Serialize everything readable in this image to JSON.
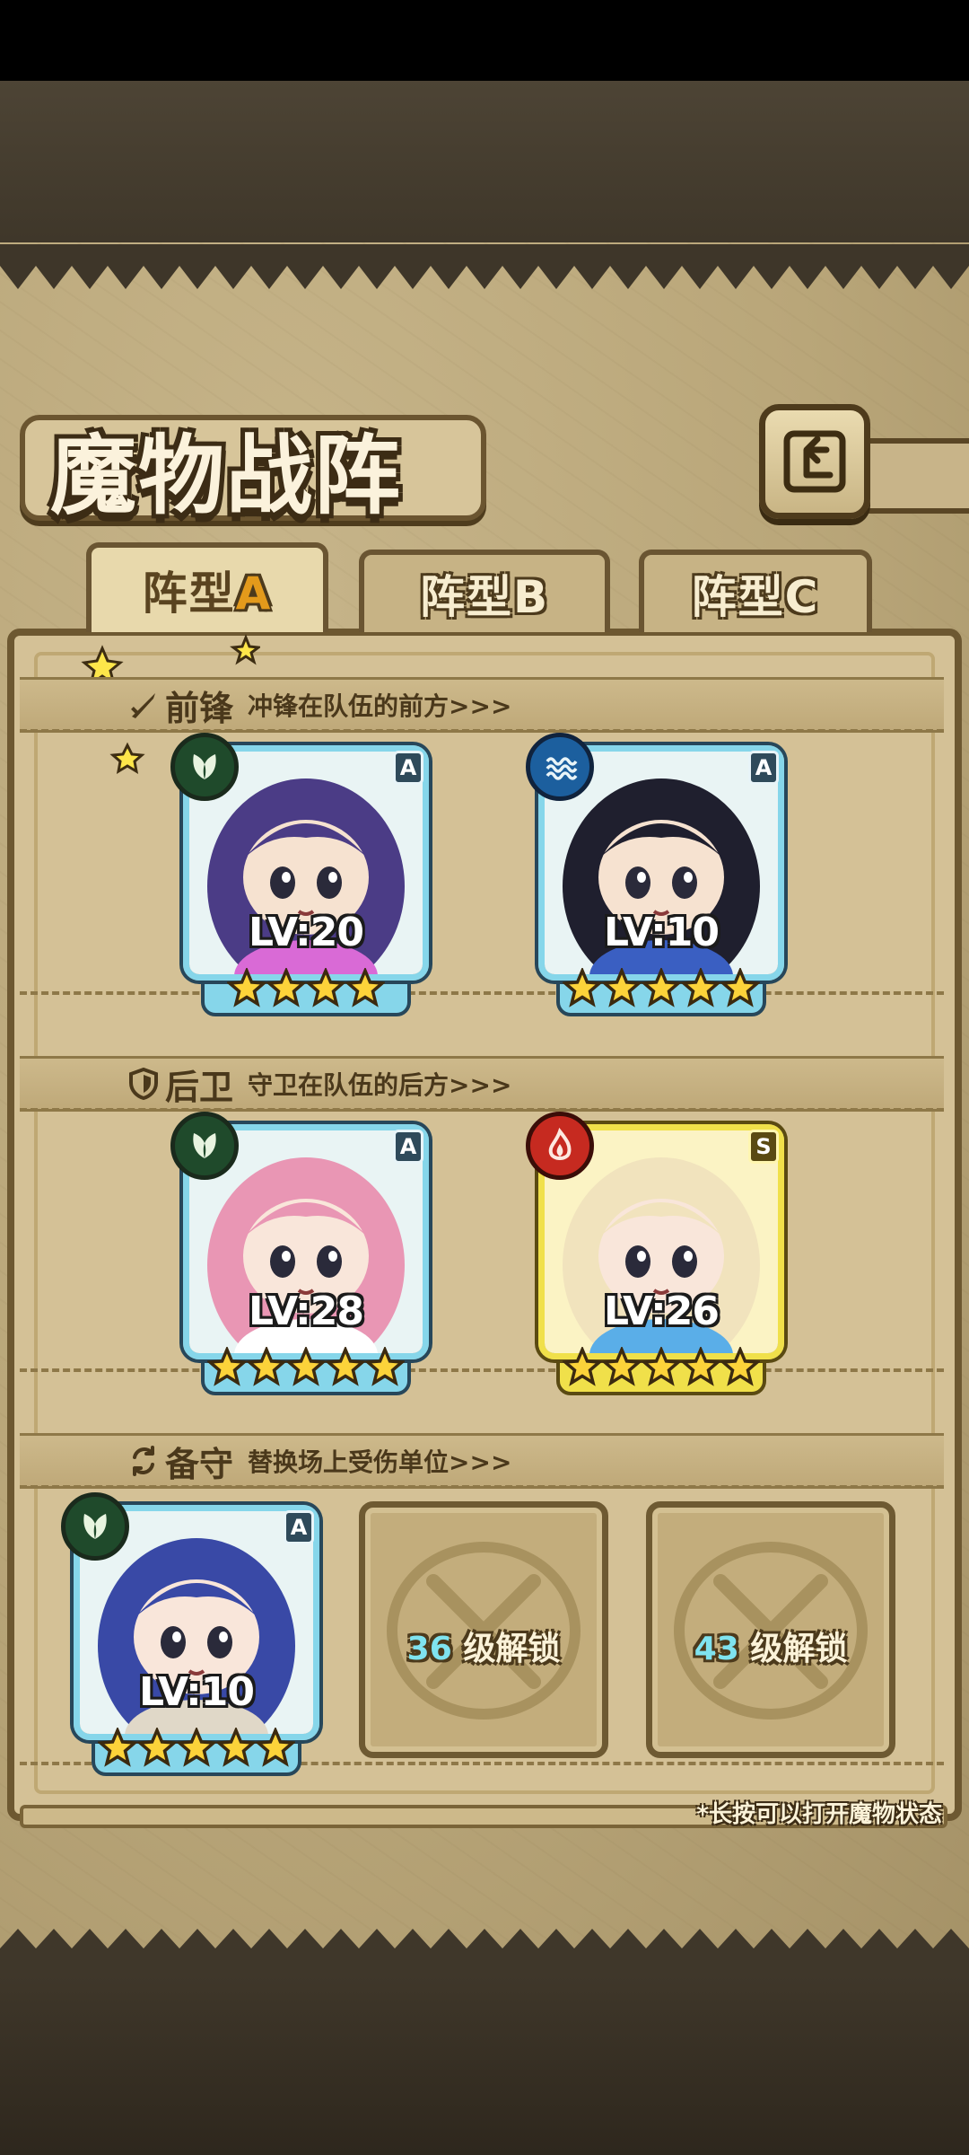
{
  "title": "魔物战阵",
  "tabs": [
    {
      "prefix": "阵型",
      "letter": "A"
    },
    {
      "prefix": "阵型",
      "letter": "B"
    },
    {
      "prefix": "阵型",
      "letter": "C"
    }
  ],
  "sections": {
    "front": {
      "title": "前锋",
      "desc": "冲锋在队伍的前方>>>"
    },
    "back": {
      "title": "后卫",
      "desc": "守卫在队伍的后方>>>"
    },
    "reserve": {
      "title": "备守",
      "desc": "替换场上受伤单位>>>"
    }
  },
  "monsters": [
    {
      "slot": "front-1",
      "level": "LV:20",
      "rank": "A",
      "element": "leaf",
      "stars": 4,
      "frame": "blue",
      "colors": {
        "hair": "#4b3c86",
        "skin": "#f6e2d0",
        "accent": "#d96ad6"
      }
    },
    {
      "slot": "front-2",
      "level": "LV:10",
      "rank": "A",
      "element": "water",
      "stars": 5,
      "frame": "blue",
      "colors": {
        "hair": "#1f1f2e",
        "skin": "#f6e2d0",
        "accent": "#3a5fc2"
      }
    },
    {
      "slot": "back-1",
      "level": "LV:28",
      "rank": "A",
      "element": "leaf",
      "stars": 5,
      "frame": "blue",
      "colors": {
        "hair": "#e996b4",
        "skin": "#f9e6da",
        "accent": "#ffffff"
      }
    },
    {
      "slot": "back-2",
      "level": "LV:26",
      "rank": "S",
      "element": "fire",
      "stars": 5,
      "frame": "gold",
      "colors": {
        "hair": "#f1e3bd",
        "skin": "#f9e6da",
        "accent": "#5aaee8"
      }
    },
    {
      "slot": "reserve-1",
      "level": "LV:10",
      "rank": "A",
      "element": "leaf",
      "stars": 5,
      "frame": "blue",
      "colors": {
        "hair": "#3949a6",
        "skin": "#f9e6da",
        "accent": "#e0d8c8"
      }
    }
  ],
  "locked_slots": [
    {
      "level": "36",
      "suffix": " 级解锁"
    },
    {
      "level": "43",
      "suffix": " 级解锁"
    }
  ],
  "hint": "*长按可以打开魔物状态"
}
